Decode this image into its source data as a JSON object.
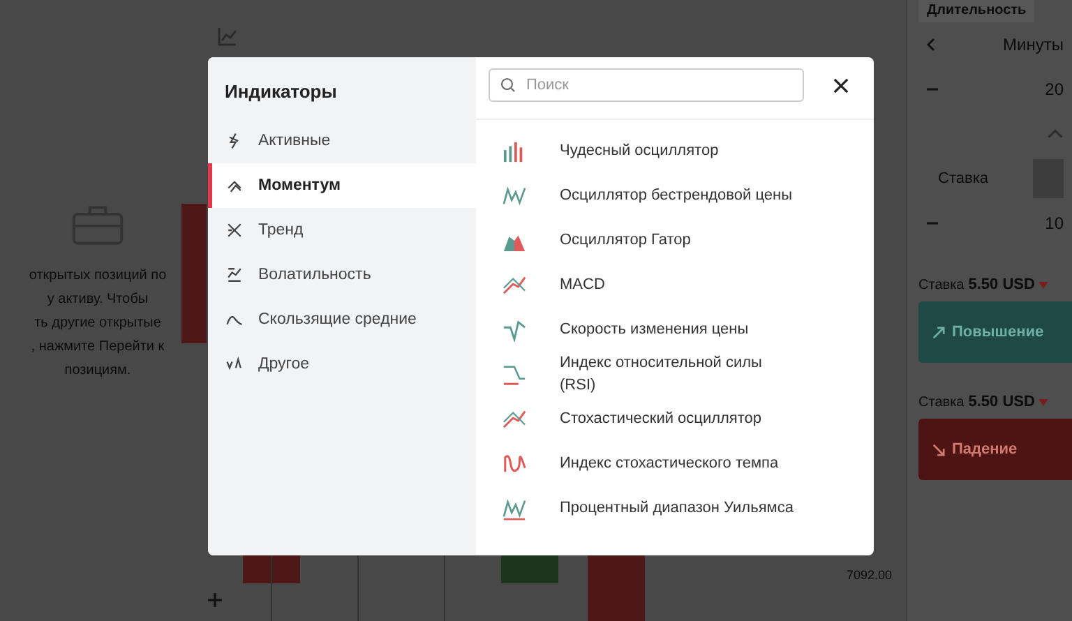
{
  "background": {
    "message": [
      "открытых позиций по",
      "у активу. Чтобы",
      "ть другие открытые",
      ", нажмите Перейти к",
      "позициям."
    ],
    "chart": {
      "price_label": "7092.00"
    },
    "trade_panel": {
      "tab": "Длительность",
      "unit": "Минуты",
      "duration": "20",
      "tabs": [
        {
          "label": "Ставка",
          "selected": false
        }
      ],
      "amount": "10",
      "stakes": [
        {
          "label": "Ставка",
          "value": "5.50 USD",
          "button": "Повышение",
          "kind": "up"
        },
        {
          "label": "Ставка",
          "value": "5.50 USD",
          "button": "Падение",
          "kind": "down"
        }
      ]
    }
  },
  "modal": {
    "title": "Индикаторы",
    "search": {
      "placeholder": "Поиск"
    },
    "categories": [
      {
        "label": "Активные",
        "selected": false
      },
      {
        "label": "Моментум",
        "selected": true
      },
      {
        "label": "Тренд",
        "selected": false
      },
      {
        "label": "Волатильность",
        "selected": false
      },
      {
        "label": "Скользящие средние",
        "selected": false
      },
      {
        "label": "Другое",
        "selected": false
      }
    ],
    "indicators": [
      {
        "label": "Чудесный осциллятор"
      },
      {
        "label": "Осциллятор бестрендовой цены"
      },
      {
        "label": "Осциллятор Гатор"
      },
      {
        "label": "MACD"
      },
      {
        "label": "Скорость изменения цены"
      },
      {
        "label": "Индекс относительной силы (RSI)"
      },
      {
        "label": "Стохастический осциллятор"
      },
      {
        "label": "Индекс стохастического темпа"
      },
      {
        "label": "Процентный диапазон Уильямса"
      }
    ]
  }
}
